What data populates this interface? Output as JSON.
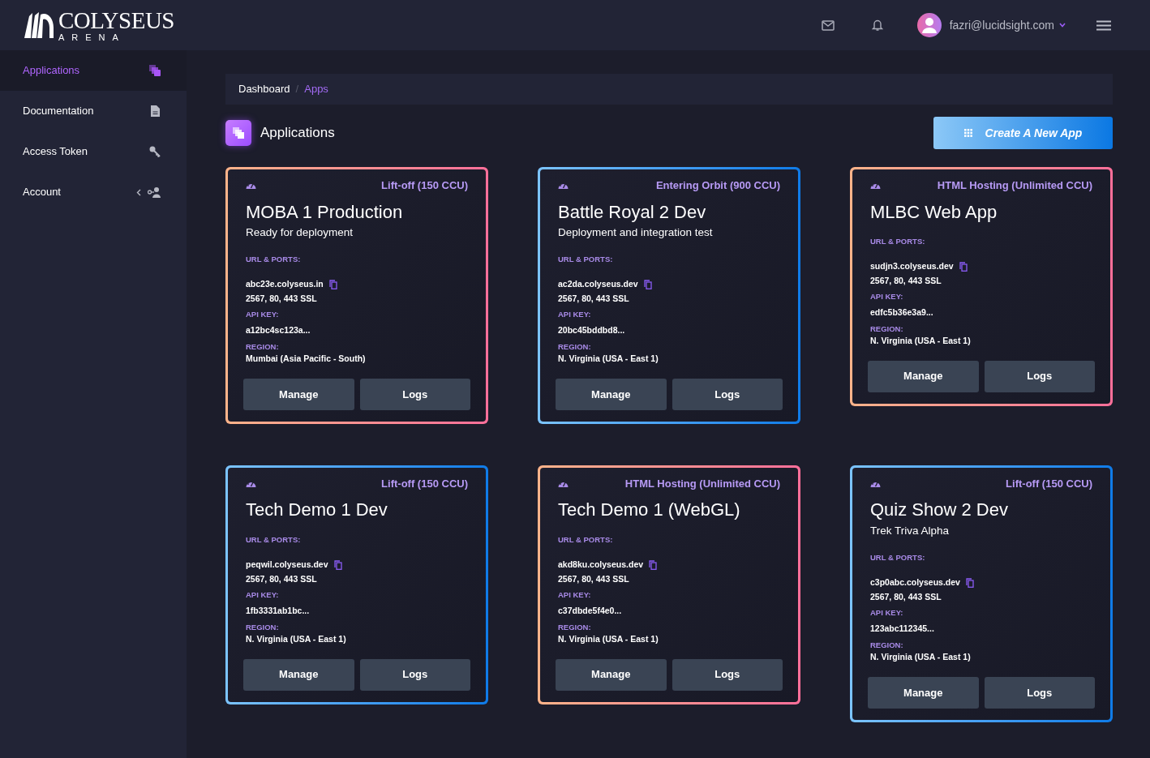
{
  "brand": {
    "name": "COLYSEUS",
    "sub": "ARENA"
  },
  "header": {
    "user_email": "fazri@lucidsight.com"
  },
  "sidebar": {
    "items": [
      {
        "label": "Applications",
        "selected": true
      },
      {
        "label": "Documentation",
        "selected": false
      },
      {
        "label": "Access Token",
        "selected": false
      },
      {
        "label": "Account",
        "selected": false
      }
    ]
  },
  "breadcrumb": {
    "separator": "/",
    "items": [
      {
        "label": "Dashboard",
        "selected": false
      },
      {
        "label": "Apps",
        "selected": true
      }
    ]
  },
  "page_title": "Applications",
  "create_button": "Create A New App",
  "apps": [
    {
      "kind": "warm",
      "plan": "Lift-off (150 CCU)",
      "name": "MOBA 1 Production",
      "description": "Ready for deployment",
      "url_label": "URL & PORTS:",
      "url": "abc23e.colyseus.in",
      "ports": "2567, 80, 443 SSL",
      "api_label": "API KEY:",
      "api_key": "a12bc4sc123a...",
      "region_label": "REGION:",
      "region": "Mumbai (Asia Pacific - South)",
      "buttons": [
        "Manage",
        "Logs"
      ]
    },
    {
      "kind": "cool",
      "plan": "Entering Orbit (900 CCU)",
      "name": "Battle Royal 2 Dev",
      "description": "Deployment and integration test",
      "url_label": "URL & PORTS:",
      "url": "ac2da.colyseus.dev",
      "ports": "2567, 80, 443 SSL",
      "api_label": "API KEY:",
      "api_key": "20bc45bddbd8...",
      "region_label": "REGION:",
      "region": "N. Virginia (USA - East 1)",
      "buttons": [
        "Manage",
        "Logs"
      ]
    },
    {
      "kind": "warm",
      "plan": "HTML Hosting (Unlimited CCU)",
      "name": "MLBC Web App",
      "url_label": "URL & PORTS:",
      "url": "sudjn3.colyseus.dev",
      "ports": "2567, 80, 443 SSL",
      "api_label": "API KEY:",
      "api_key": "edfc5b36e3a9...",
      "region_label": "REGION:",
      "region": "N. Virginia (USA - East 1)",
      "buttons": [
        "Manage",
        "Logs"
      ]
    },
    {
      "kind": "cool",
      "plan": "Lift-off (150 CCU)",
      "name": "Tech Demo 1 Dev",
      "url_label": "URL & PORTS:",
      "url": "peqwil.colyseus.dev",
      "ports": "2567, 80, 443 SSL",
      "api_label": "API KEY:",
      "api_key": "1fb3331ab1bc...",
      "region_label": "REGION:",
      "region": "N. Virginia (USA - East 1)",
      "buttons": [
        "Manage",
        "Logs"
      ]
    },
    {
      "kind": "warm",
      "plan": "HTML Hosting (Unlimited CCU)",
      "name": "Tech Demo 1 (WebGL)",
      "url_label": "URL & PORTS:",
      "url": "akd8ku.colyseus.dev",
      "ports": "2567, 80, 443 SSL",
      "api_label": "API KEY:",
      "api_key": "c37dbde5f4e0...",
      "region_label": "REGION:",
      "region": "N. Virginia (USA - East 1)",
      "buttons": [
        "Manage",
        "Logs"
      ]
    },
    {
      "kind": "cool",
      "plan": "Lift-off (150 CCU)",
      "name": "Quiz Show 2 Dev",
      "description": "Trek Triva Alpha",
      "url_label": "URL & PORTS:",
      "url": "c3p0abc.colyseus.dev",
      "ports": "2567, 80, 443 SSL",
      "api_label": "API KEY:",
      "api_key": "123abc112345...",
      "region_label": "REGION:",
      "region": "N. Virginia (USA - East 1)",
      "buttons": [
        "Manage",
        "Logs"
      ]
    }
  ]
}
